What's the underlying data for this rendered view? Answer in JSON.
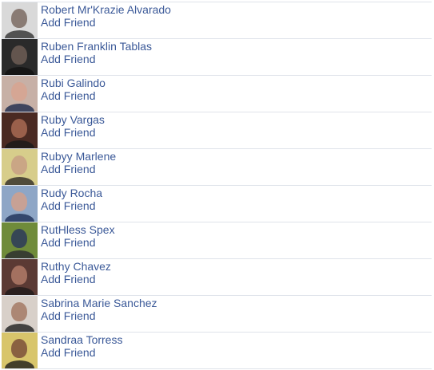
{
  "people": [
    {
      "name": "Robert Mr'Krazie Alvarado",
      "action": "Add Friend",
      "avatar": {
        "bg": "#d9d9d9",
        "face": "#7a6a62",
        "body": "#2f2f2f"
      }
    },
    {
      "name": "Ruben Franklin Tablas",
      "action": "Add Friend",
      "avatar": {
        "bg": "#2a2a2a",
        "face": "#6d5d55",
        "body": "#111111"
      }
    },
    {
      "name": "Rubi Galindo",
      "action": "Add Friend",
      "avatar": {
        "bg": "#c7b0a6",
        "face": "#d7a590",
        "body": "#1d2a4c"
      }
    },
    {
      "name": "Ruby Vargas",
      "action": "Add Friend",
      "avatar": {
        "bg": "#4a2a22",
        "face": "#a86a52",
        "body": "#191919"
      }
    },
    {
      "name": "Rubyy Marlene",
      "action": "Add Friend",
      "avatar": {
        "bg": "#d7cd8b",
        "face": "#c89f84",
        "body": "#2f2a24"
      }
    },
    {
      "name": "Rudy Rocha",
      "action": "Add Friend",
      "avatar": {
        "bg": "#8ea6c6",
        "face": "#d1a08c",
        "body": "#1e2f56"
      }
    },
    {
      "name": "RutHless Spex",
      "action": "Add Friend",
      "avatar": {
        "bg": "#6f8b3a",
        "face": "#2d3a5a",
        "body": "#2b2a2f"
      }
    },
    {
      "name": "Ruthy Chavez",
      "action": "Add Friend",
      "avatar": {
        "bg": "#5b3a34",
        "face": "#b27b69",
        "body": "#1f1a1a"
      }
    },
    {
      "name": "Sabrina Marie Sanchez",
      "action": "Add Friend",
      "avatar": {
        "bg": "#d8d0c9",
        "face": "#a57a65",
        "body": "#1f1f1f"
      }
    },
    {
      "name": "Sandraa Torress",
      "action": "Add Friend",
      "avatar": {
        "bg": "#d8c56b",
        "face": "#7c4f3a",
        "body": "#1f1d1c"
      }
    }
  ]
}
